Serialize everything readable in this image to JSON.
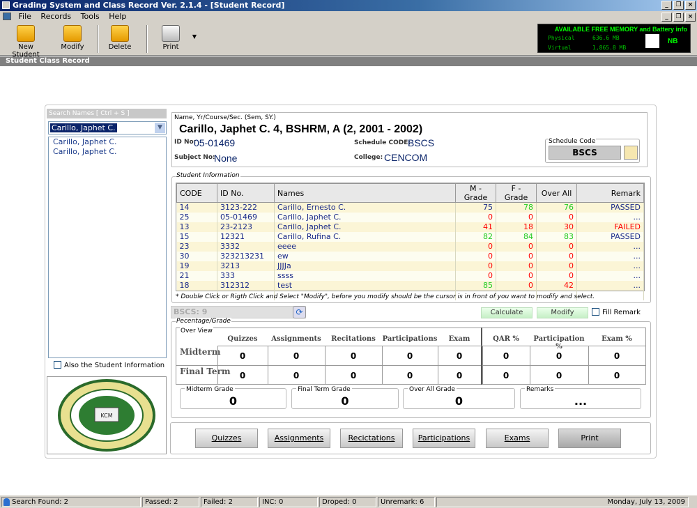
{
  "window": {
    "title": "Grading System and Class Record  Ver. 2.1.4 - [Student Record]"
  },
  "menu": [
    "File",
    "Records",
    "Tools",
    "Help"
  ],
  "toolbar": {
    "new_student": "New Student",
    "modify": "Modify",
    "delete": "Delete",
    "print": "Print"
  },
  "memory": {
    "title": "AVAILABLE FREE MEMORY and Battery info",
    "physical_label": "Physical",
    "physical_value": "636.6 MB",
    "virtual_label": "Virtual",
    "virtual_value": "1,865.8 MB",
    "battery": "NB"
  },
  "form_title": "Student Class Record",
  "search": {
    "header": "Search Names [ Ctrl + S ]",
    "selected": "Carillo, Japhet C.",
    "results": [
      "Carillo, Japhet C.",
      "Carillo, Japhet C."
    ],
    "also_student_info": "Also the Student Information"
  },
  "student": {
    "name_label": "Name, Yr/Course/Sec. (Sem, SY.)",
    "name_line": "Carillo, Japhet C.   4, BSHRM, A (2, 2001 - 2002)",
    "id_label": "ID No:",
    "id": "05-01469",
    "subject_label": "Subject No:",
    "subject": "None",
    "sched_label": "Schedule CODE:",
    "sched": "BSCS",
    "college_label": "College:",
    "college": "CENCOM",
    "schedule_code_label": "Schedule Code",
    "schedule_code": "BSCS"
  },
  "student_info": {
    "label": "Student Information",
    "columns": [
      "CODE",
      "ID No.",
      "Names",
      "M - Grade",
      "F - Grade",
      "Over All",
      "Remark"
    ],
    "rows": [
      {
        "code": "14",
        "id": "3123-222",
        "name": "Carillo, Ernesto C.",
        "m": "75",
        "f": "78",
        "o": "76",
        "remark": "PASSED"
      },
      {
        "code": "25",
        "id": "05-01469",
        "name": "Carillo, Japhet C.",
        "m": "0",
        "f": "0",
        "o": "0",
        "remark": "..."
      },
      {
        "code": "13",
        "id": "23-2123",
        "name": "Carillo, Japhet C.",
        "m": "41",
        "f": "18",
        "o": "30",
        "remark": "FAILED"
      },
      {
        "code": "15",
        "id": "12321",
        "name": "Carillo, Rufina C.",
        "m": "82",
        "f": "84",
        "o": "83",
        "remark": "PASSED"
      },
      {
        "code": "23",
        "id": "3332",
        "name": "eeee",
        "m": "0",
        "f": "0",
        "o": "0",
        "remark": "..."
      },
      {
        "code": "30",
        "id": "323213231",
        "name": "ew",
        "m": "0",
        "f": "0",
        "o": "0",
        "remark": "..."
      },
      {
        "code": "19",
        "id": "3213",
        "name": "JJJJa",
        "m": "0",
        "f": "0",
        "o": "0",
        "remark": "..."
      },
      {
        "code": "21",
        "id": "333",
        "name": "ssss",
        "m": "0",
        "f": "0",
        "o": "0",
        "remark": "..."
      },
      {
        "code": "18",
        "id": "312312",
        "name": "test",
        "m": "85",
        "f": "0",
        "o": "42",
        "remark": "..."
      }
    ]
  },
  "note": "* Double Click or Rigth Click and Select \"Modify\", before you modify should be the cursor is in front of you want to modify and select.",
  "bscs_field": "BSCS: 9",
  "actions": {
    "calculate": "Calculate",
    "modify": "Modify",
    "fill_remark": "Fill Remark"
  },
  "grades": {
    "group_label": "Pecentage/Grade",
    "overview_label": "Over View",
    "headers": [
      "Quizzes",
      "Assignments",
      "Recitations",
      "Participations",
      "Exam",
      "QAR %",
      "Participation %",
      "Exam %"
    ],
    "midterm_label": "Midterm",
    "finalterm_label": "Final Term",
    "midterm": [
      "0",
      "0",
      "0",
      "0",
      "0",
      "0",
      "0",
      "0"
    ],
    "finalterm": [
      "0",
      "0",
      "0",
      "0",
      "0",
      "0",
      "0",
      "0"
    ],
    "midterm_grade_label": "Midterm Grade",
    "midterm_grade": "0",
    "finalterm_grade_label": "Final Term Grade",
    "finalterm_grade": "0",
    "overall_grade_label": "Over All Grade",
    "overall_grade": "0",
    "remarks_label": "Remarks",
    "remarks": "..."
  },
  "bottom_buttons": [
    "Quizzes",
    "Assignments",
    "Recictations",
    "Participations",
    "Exams",
    "Print"
  ],
  "status": {
    "search_found": "Search Found: 2",
    "passed": "Passed: 2",
    "failed": "Failed: 2",
    "inc": "INC: 0",
    "dropped": "Droped: 0",
    "unremark": "Unremark: 6",
    "date": "Monday, July 13, 2009"
  },
  "colors": {
    "accent": "#0a246a",
    "pass_green": "#22cc22",
    "fail_red": "#ff0000"
  }
}
